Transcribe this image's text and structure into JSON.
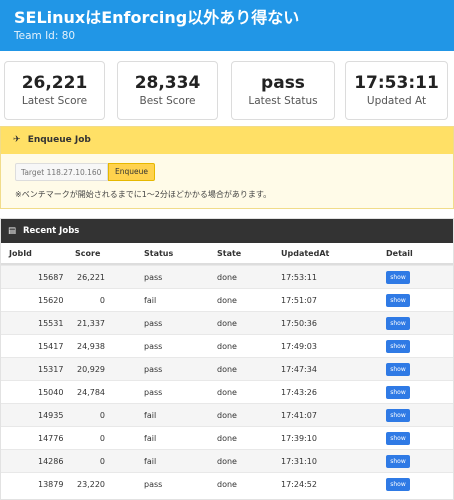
{
  "header": {
    "title": "SELinuxはEnforcing以外あり得ない",
    "team": "Team Id: 80"
  },
  "stats": [
    {
      "value": "26,221",
      "label": "Latest Score"
    },
    {
      "value": "28,334",
      "label": "Best Score"
    },
    {
      "value": "pass",
      "label": "Latest Status"
    },
    {
      "value": "17:53:11",
      "label": "Updated At"
    }
  ],
  "enqueue": {
    "title": "Enqueue Job",
    "target_placeholder": "Target 118.27.10.160",
    "button_label": "Enqueue",
    "note": "※ベンチマークが開始されるまでに1〜2分ほどかかる場合があります。"
  },
  "jobs": {
    "title": "Recent Jobs",
    "columns": [
      "JobId",
      "Score",
      "Status",
      "State",
      "UpdatedAt",
      "Detail"
    ],
    "rows": [
      {
        "id": "15687",
        "score": "26,221",
        "status": "pass",
        "state": "done",
        "updated": "17:53:11",
        "detail": "show"
      },
      {
        "id": "15620",
        "score": "0",
        "status": "fail",
        "state": "done",
        "updated": "17:51:07",
        "detail": "show"
      },
      {
        "id": "15531",
        "score": "21,337",
        "status": "pass",
        "state": "done",
        "updated": "17:50:36",
        "detail": "show"
      },
      {
        "id": "15417",
        "score": "24,938",
        "status": "pass",
        "state": "done",
        "updated": "17:49:03",
        "detail": "show"
      },
      {
        "id": "15317",
        "score": "20,929",
        "status": "pass",
        "state": "done",
        "updated": "17:47:34",
        "detail": "show"
      },
      {
        "id": "15040",
        "score": "24,784",
        "status": "pass",
        "state": "done",
        "updated": "17:43:26",
        "detail": "show"
      },
      {
        "id": "14935",
        "score": "0",
        "status": "fail",
        "state": "done",
        "updated": "17:41:07",
        "detail": "show"
      },
      {
        "id": "14776",
        "score": "0",
        "status": "fail",
        "state": "done",
        "updated": "17:39:10",
        "detail": "show"
      },
      {
        "id": "14286",
        "score": "0",
        "status": "fail",
        "state": "done",
        "updated": "17:31:10",
        "detail": "show"
      },
      {
        "id": "13879",
        "score": "23,220",
        "status": "pass",
        "state": "done",
        "updated": "17:24:52",
        "detail": "show"
      }
    ]
  },
  "colors": {
    "header_bg": "#2196e6",
    "enqueue_bg": "#ffe066",
    "jobs_header_bg": "#333333",
    "show_button": "#2f7ae5"
  },
  "icons": {
    "enqueue": "paper-plane-icon",
    "jobs": "list-icon"
  }
}
